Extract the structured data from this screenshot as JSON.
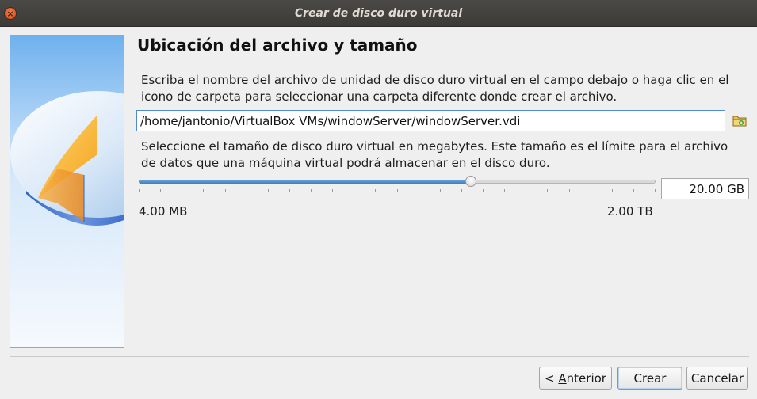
{
  "window": {
    "title": "Crear de disco duro virtual",
    "close_glyph": "×"
  },
  "page": {
    "title": "Ubicación del archivo y tamaño",
    "description_file": "Escriba el nombre del archivo de unidad de disco duro virtual en el campo debajo o haga clic en el icono de carpeta para seleccionar una carpeta diferente donde crear el archivo.",
    "description_size": "Seleccione el tamaño de disco duro virtual en megabytes. Este tamaño es el límite para el archivo de datos que una máquina virtual podrá almacenar en el disco duro."
  },
  "file": {
    "path": "/home/jantonio/VirtualBox VMs/windowServer/windowServer.vdi",
    "folder_icon": "folder-icon"
  },
  "size": {
    "value_label": "20.00 GB",
    "min_label": "4.00 MB",
    "max_label": "2.00 TB",
    "slider_fraction": 0.643
  },
  "buttons": {
    "back_prefix": "< ",
    "back_mnemonic": "A",
    "back_rest": "nterior",
    "create": "Crear",
    "cancel": "Cancelar"
  },
  "colors": {
    "titlebar": "#3c3b37",
    "close_button": "#df4a16",
    "accent": "#3d7fbf"
  }
}
